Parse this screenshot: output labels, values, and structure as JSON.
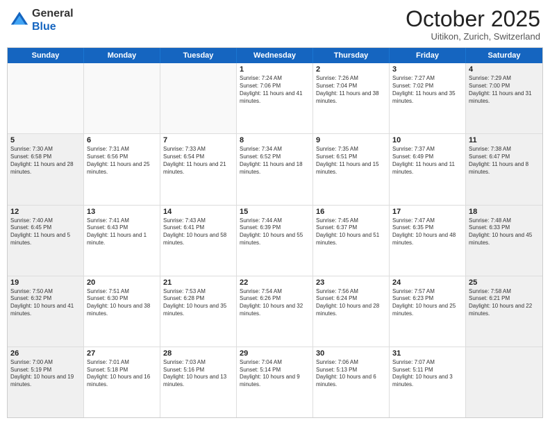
{
  "header": {
    "logo_line1": "General",
    "logo_line2": "Blue",
    "month_title": "October 2025",
    "location": "Uitikon, Zurich, Switzerland"
  },
  "weekdays": [
    "Sunday",
    "Monday",
    "Tuesday",
    "Wednesday",
    "Thursday",
    "Friday",
    "Saturday"
  ],
  "rows": [
    [
      {
        "day": "",
        "sunrise": "",
        "sunset": "",
        "daylight": "",
        "shaded": false
      },
      {
        "day": "",
        "sunrise": "",
        "sunset": "",
        "daylight": "",
        "shaded": false
      },
      {
        "day": "",
        "sunrise": "",
        "sunset": "",
        "daylight": "",
        "shaded": false
      },
      {
        "day": "1",
        "sunrise": "Sunrise: 7:24 AM",
        "sunset": "Sunset: 7:06 PM",
        "daylight": "Daylight: 11 hours and 41 minutes.",
        "shaded": false
      },
      {
        "day": "2",
        "sunrise": "Sunrise: 7:26 AM",
        "sunset": "Sunset: 7:04 PM",
        "daylight": "Daylight: 11 hours and 38 minutes.",
        "shaded": false
      },
      {
        "day": "3",
        "sunrise": "Sunrise: 7:27 AM",
        "sunset": "Sunset: 7:02 PM",
        "daylight": "Daylight: 11 hours and 35 minutes.",
        "shaded": false
      },
      {
        "day": "4",
        "sunrise": "Sunrise: 7:29 AM",
        "sunset": "Sunset: 7:00 PM",
        "daylight": "Daylight: 11 hours and 31 minutes.",
        "shaded": true
      }
    ],
    [
      {
        "day": "5",
        "sunrise": "Sunrise: 7:30 AM",
        "sunset": "Sunset: 6:58 PM",
        "daylight": "Daylight: 11 hours and 28 minutes.",
        "shaded": true
      },
      {
        "day": "6",
        "sunrise": "Sunrise: 7:31 AM",
        "sunset": "Sunset: 6:56 PM",
        "daylight": "Daylight: 11 hours and 25 minutes.",
        "shaded": false
      },
      {
        "day": "7",
        "sunrise": "Sunrise: 7:33 AM",
        "sunset": "Sunset: 6:54 PM",
        "daylight": "Daylight: 11 hours and 21 minutes.",
        "shaded": false
      },
      {
        "day": "8",
        "sunrise": "Sunrise: 7:34 AM",
        "sunset": "Sunset: 6:52 PM",
        "daylight": "Daylight: 11 hours and 18 minutes.",
        "shaded": false
      },
      {
        "day": "9",
        "sunrise": "Sunrise: 7:35 AM",
        "sunset": "Sunset: 6:51 PM",
        "daylight": "Daylight: 11 hours and 15 minutes.",
        "shaded": false
      },
      {
        "day": "10",
        "sunrise": "Sunrise: 7:37 AM",
        "sunset": "Sunset: 6:49 PM",
        "daylight": "Daylight: 11 hours and 11 minutes.",
        "shaded": false
      },
      {
        "day": "11",
        "sunrise": "Sunrise: 7:38 AM",
        "sunset": "Sunset: 6:47 PM",
        "daylight": "Daylight: 11 hours and 8 minutes.",
        "shaded": true
      }
    ],
    [
      {
        "day": "12",
        "sunrise": "Sunrise: 7:40 AM",
        "sunset": "Sunset: 6:45 PM",
        "daylight": "Daylight: 11 hours and 5 minutes.",
        "shaded": true
      },
      {
        "day": "13",
        "sunrise": "Sunrise: 7:41 AM",
        "sunset": "Sunset: 6:43 PM",
        "daylight": "Daylight: 11 hours and 1 minute.",
        "shaded": false
      },
      {
        "day": "14",
        "sunrise": "Sunrise: 7:43 AM",
        "sunset": "Sunset: 6:41 PM",
        "daylight": "Daylight: 10 hours and 58 minutes.",
        "shaded": false
      },
      {
        "day": "15",
        "sunrise": "Sunrise: 7:44 AM",
        "sunset": "Sunset: 6:39 PM",
        "daylight": "Daylight: 10 hours and 55 minutes.",
        "shaded": false
      },
      {
        "day": "16",
        "sunrise": "Sunrise: 7:45 AM",
        "sunset": "Sunset: 6:37 PM",
        "daylight": "Daylight: 10 hours and 51 minutes.",
        "shaded": false
      },
      {
        "day": "17",
        "sunrise": "Sunrise: 7:47 AM",
        "sunset": "Sunset: 6:35 PM",
        "daylight": "Daylight: 10 hours and 48 minutes.",
        "shaded": false
      },
      {
        "day": "18",
        "sunrise": "Sunrise: 7:48 AM",
        "sunset": "Sunset: 6:33 PM",
        "daylight": "Daylight: 10 hours and 45 minutes.",
        "shaded": true
      }
    ],
    [
      {
        "day": "19",
        "sunrise": "Sunrise: 7:50 AM",
        "sunset": "Sunset: 6:32 PM",
        "daylight": "Daylight: 10 hours and 41 minutes.",
        "shaded": true
      },
      {
        "day": "20",
        "sunrise": "Sunrise: 7:51 AM",
        "sunset": "Sunset: 6:30 PM",
        "daylight": "Daylight: 10 hours and 38 minutes.",
        "shaded": false
      },
      {
        "day": "21",
        "sunrise": "Sunrise: 7:53 AM",
        "sunset": "Sunset: 6:28 PM",
        "daylight": "Daylight: 10 hours and 35 minutes.",
        "shaded": false
      },
      {
        "day": "22",
        "sunrise": "Sunrise: 7:54 AM",
        "sunset": "Sunset: 6:26 PM",
        "daylight": "Daylight: 10 hours and 32 minutes.",
        "shaded": false
      },
      {
        "day": "23",
        "sunrise": "Sunrise: 7:56 AM",
        "sunset": "Sunset: 6:24 PM",
        "daylight": "Daylight: 10 hours and 28 minutes.",
        "shaded": false
      },
      {
        "day": "24",
        "sunrise": "Sunrise: 7:57 AM",
        "sunset": "Sunset: 6:23 PM",
        "daylight": "Daylight: 10 hours and 25 minutes.",
        "shaded": false
      },
      {
        "day": "25",
        "sunrise": "Sunrise: 7:58 AM",
        "sunset": "Sunset: 6:21 PM",
        "daylight": "Daylight: 10 hours and 22 minutes.",
        "shaded": true
      }
    ],
    [
      {
        "day": "26",
        "sunrise": "Sunrise: 7:00 AM",
        "sunset": "Sunset: 5:19 PM",
        "daylight": "Daylight: 10 hours and 19 minutes.",
        "shaded": true
      },
      {
        "day": "27",
        "sunrise": "Sunrise: 7:01 AM",
        "sunset": "Sunset: 5:18 PM",
        "daylight": "Daylight: 10 hours and 16 minutes.",
        "shaded": false
      },
      {
        "day": "28",
        "sunrise": "Sunrise: 7:03 AM",
        "sunset": "Sunset: 5:16 PM",
        "daylight": "Daylight: 10 hours and 13 minutes.",
        "shaded": false
      },
      {
        "day": "29",
        "sunrise": "Sunrise: 7:04 AM",
        "sunset": "Sunset: 5:14 PM",
        "daylight": "Daylight: 10 hours and 9 minutes.",
        "shaded": false
      },
      {
        "day": "30",
        "sunrise": "Sunrise: 7:06 AM",
        "sunset": "Sunset: 5:13 PM",
        "daylight": "Daylight: 10 hours and 6 minutes.",
        "shaded": false
      },
      {
        "day": "31",
        "sunrise": "Sunrise: 7:07 AM",
        "sunset": "Sunset: 5:11 PM",
        "daylight": "Daylight: 10 hours and 3 minutes.",
        "shaded": false
      },
      {
        "day": "",
        "sunrise": "",
        "sunset": "",
        "daylight": "",
        "shaded": true
      }
    ]
  ]
}
